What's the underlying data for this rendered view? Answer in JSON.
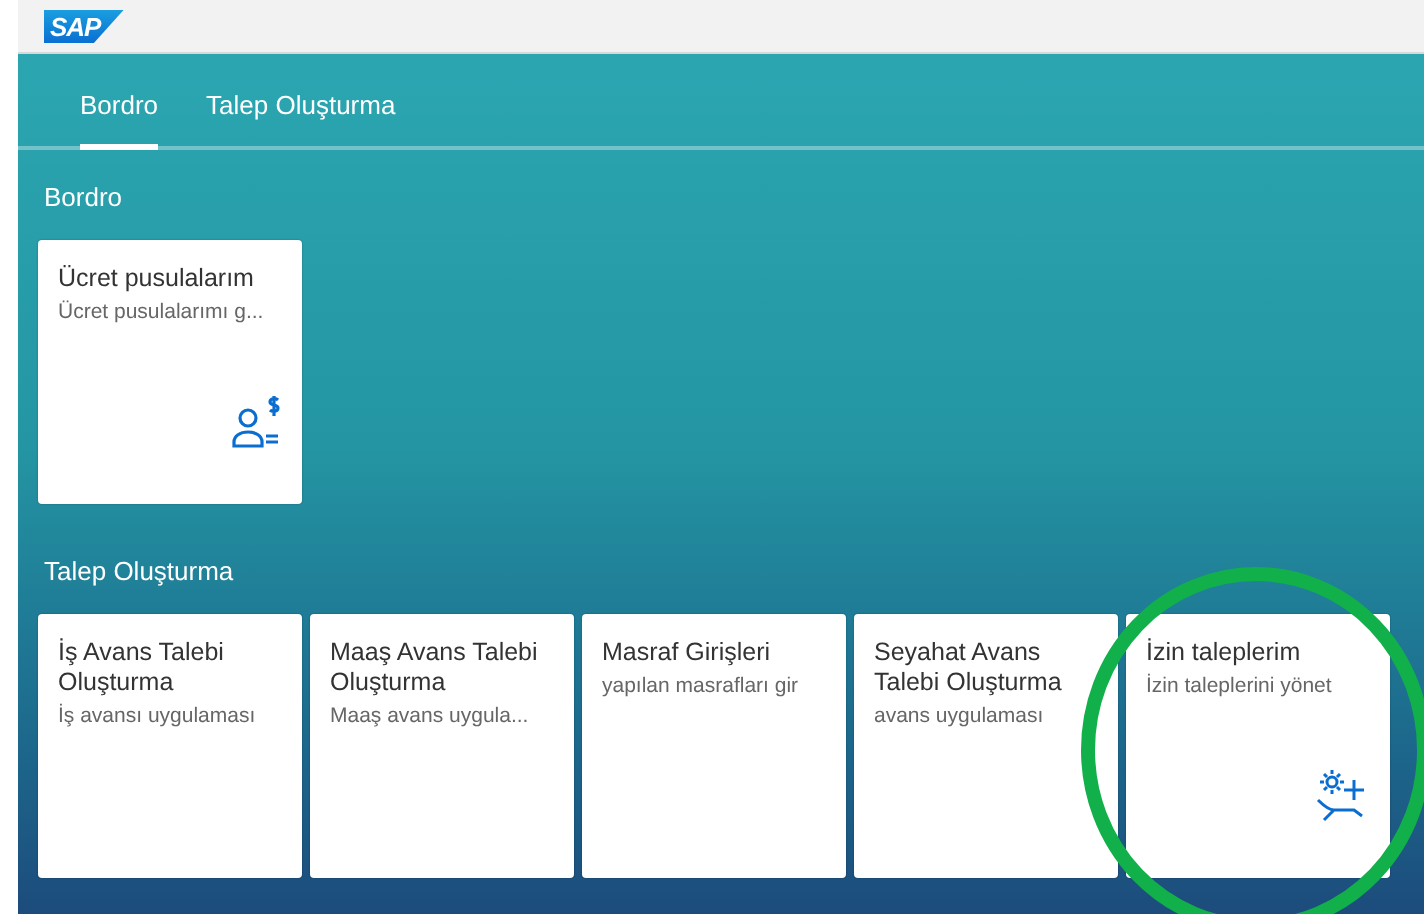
{
  "header": {
    "logo": "SAP"
  },
  "tabs": [
    {
      "label": "Bordro",
      "selected": true
    },
    {
      "label": "Talep Oluşturma",
      "selected": false
    }
  ],
  "sections": [
    {
      "title": "Bordro",
      "tiles": [
        {
          "title": "Ücret pusulalarım",
          "subtitle": "Ücret pusulalarımı g...",
          "kind": "payslip"
        }
      ]
    },
    {
      "title": "Talep Oluşturma",
      "tiles": [
        {
          "title": "İş Avans Talebi Oluşturma",
          "subtitle": "İş avansı uygulaması"
        },
        {
          "title": "Maaş Avans Talebi Oluşturma",
          "subtitle": "Maaş avans uygula..."
        },
        {
          "title": "Masraf Girişleri",
          "subtitle": "yapılan masrafları gir"
        },
        {
          "title": "Seyahat Avans Talebi Oluşturma",
          "subtitle": "avans uygulaması"
        },
        {
          "title": "İzin taleplerim",
          "subtitle": "İzin taleplerini yönet",
          "kind": "leave"
        }
      ]
    }
  ]
}
